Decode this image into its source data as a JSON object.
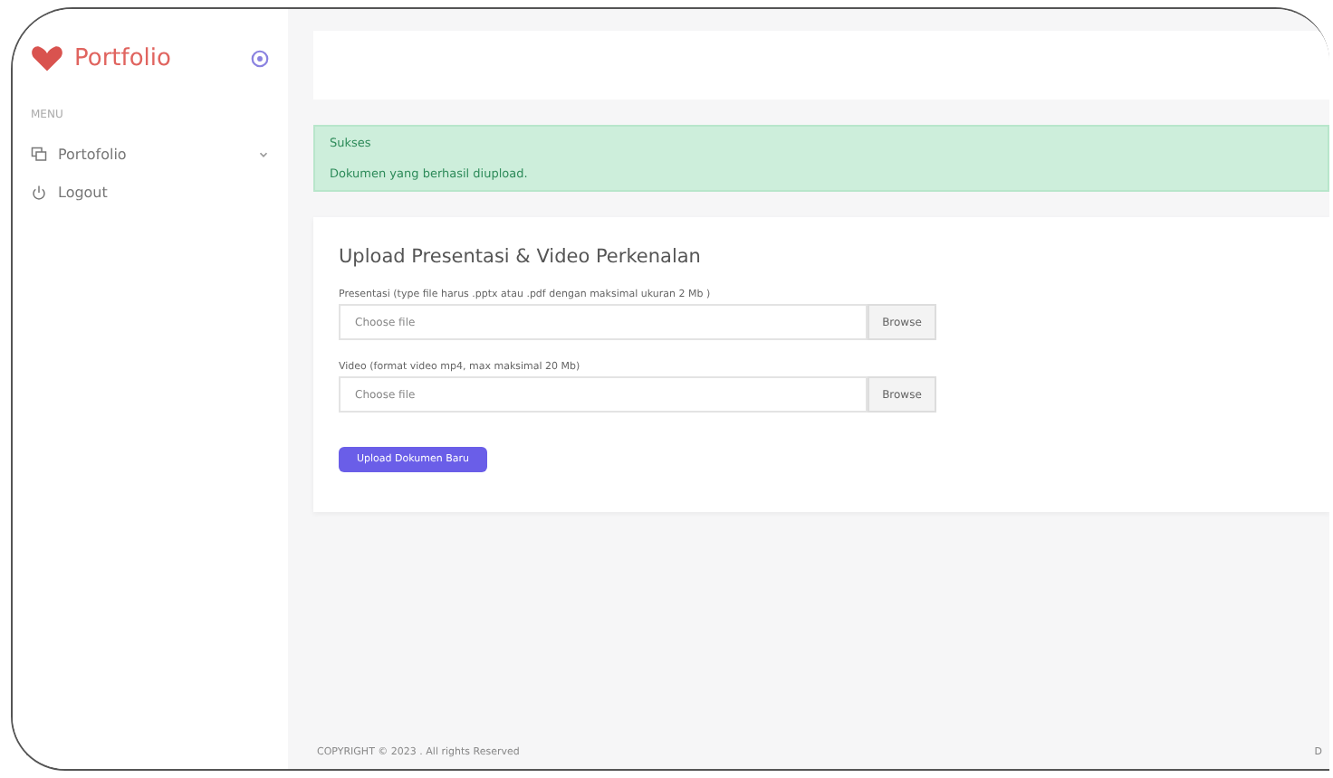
{
  "sidebar": {
    "brand": "Portfolio",
    "section_label": "MENU",
    "items": [
      {
        "label": "Portofolio",
        "kind": "folder",
        "expandable": true,
        "selected": false
      },
      {
        "label": "Logout",
        "kind": "power",
        "expandable": false,
        "selected": false
      }
    ]
  },
  "alert": {
    "title": "Sukses",
    "message": "Dokumen yang berhasil diupload."
  },
  "card": {
    "title": "Upload Presentasi & Video Perkenalan",
    "fields": [
      {
        "label": "Presentasi (type file harus .pptx atau .pdf dengan maksimal ukuran 2 Mb )",
        "placeholder": "Choose file",
        "button": "Browse"
      },
      {
        "label": "Video (format video mp4, max maksimal 20 Mb)",
        "placeholder": "Choose file",
        "button": "Browse"
      }
    ],
    "submit": "Upload Dokumen Baru"
  },
  "footer": {
    "copyright": "COPYRIGHT © 2023 . All rights Reserved",
    "right": "D"
  }
}
